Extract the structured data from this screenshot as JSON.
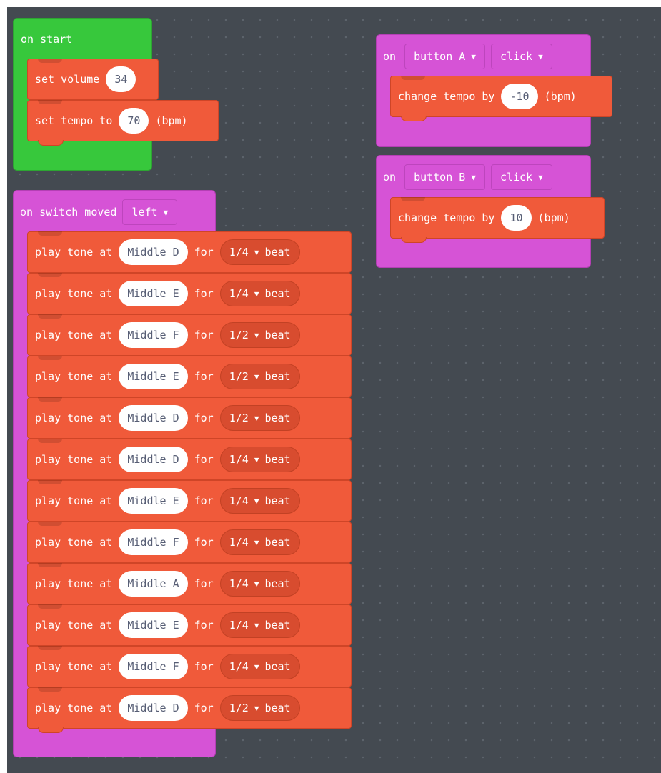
{
  "colors": {
    "workspace": "#444a51",
    "event_green": "#37c83c",
    "event_purple": "#d653d6",
    "music_orange": "#f05a3a"
  },
  "on_start": {
    "label": "on start",
    "set_volume": {
      "text": "set volume",
      "value": "34"
    },
    "set_tempo": {
      "text": "set tempo to",
      "value": "70",
      "unit": "(bpm)"
    }
  },
  "switch_handler": {
    "label": "on switch moved",
    "direction": "left",
    "tones": [
      {
        "text": "play tone at",
        "note": "Middle D",
        "for": "for",
        "beat": "1/4",
        "unit": "beat"
      },
      {
        "text": "play tone at",
        "note": "Middle E",
        "for": "for",
        "beat": "1/4",
        "unit": "beat"
      },
      {
        "text": "play tone at",
        "note": "Middle F",
        "for": "for",
        "beat": "1/2",
        "unit": "beat"
      },
      {
        "text": "play tone at",
        "note": "Middle E",
        "for": "for",
        "beat": "1/2",
        "unit": "beat"
      },
      {
        "text": "play tone at",
        "note": "Middle D",
        "for": "for",
        "beat": "1/2",
        "unit": "beat"
      },
      {
        "text": "play tone at",
        "note": "Middle D",
        "for": "for",
        "beat": "1/4",
        "unit": "beat"
      },
      {
        "text": "play tone at",
        "note": "Middle E",
        "for": "for",
        "beat": "1/4",
        "unit": "beat"
      },
      {
        "text": "play tone at",
        "note": "Middle F",
        "for": "for",
        "beat": "1/4",
        "unit": "beat"
      },
      {
        "text": "play tone at",
        "note": "Middle A",
        "for": "for",
        "beat": "1/4",
        "unit": "beat"
      },
      {
        "text": "play tone at",
        "note": "Middle E",
        "for": "for",
        "beat": "1/4",
        "unit": "beat"
      },
      {
        "text": "play tone at",
        "note": "Middle F",
        "for": "for",
        "beat": "1/4",
        "unit": "beat"
      },
      {
        "text": "play tone at",
        "note": "Middle D",
        "for": "for",
        "beat": "1/2",
        "unit": "beat"
      }
    ]
  },
  "button_a": {
    "on": "on",
    "button": "button A",
    "event": "click",
    "change": {
      "text": "change tempo by",
      "value": "-10",
      "unit": "(bpm)"
    }
  },
  "button_b": {
    "on": "on",
    "button": "button B",
    "event": "click",
    "change": {
      "text": "change tempo by",
      "value": "10",
      "unit": "(bpm)"
    }
  }
}
